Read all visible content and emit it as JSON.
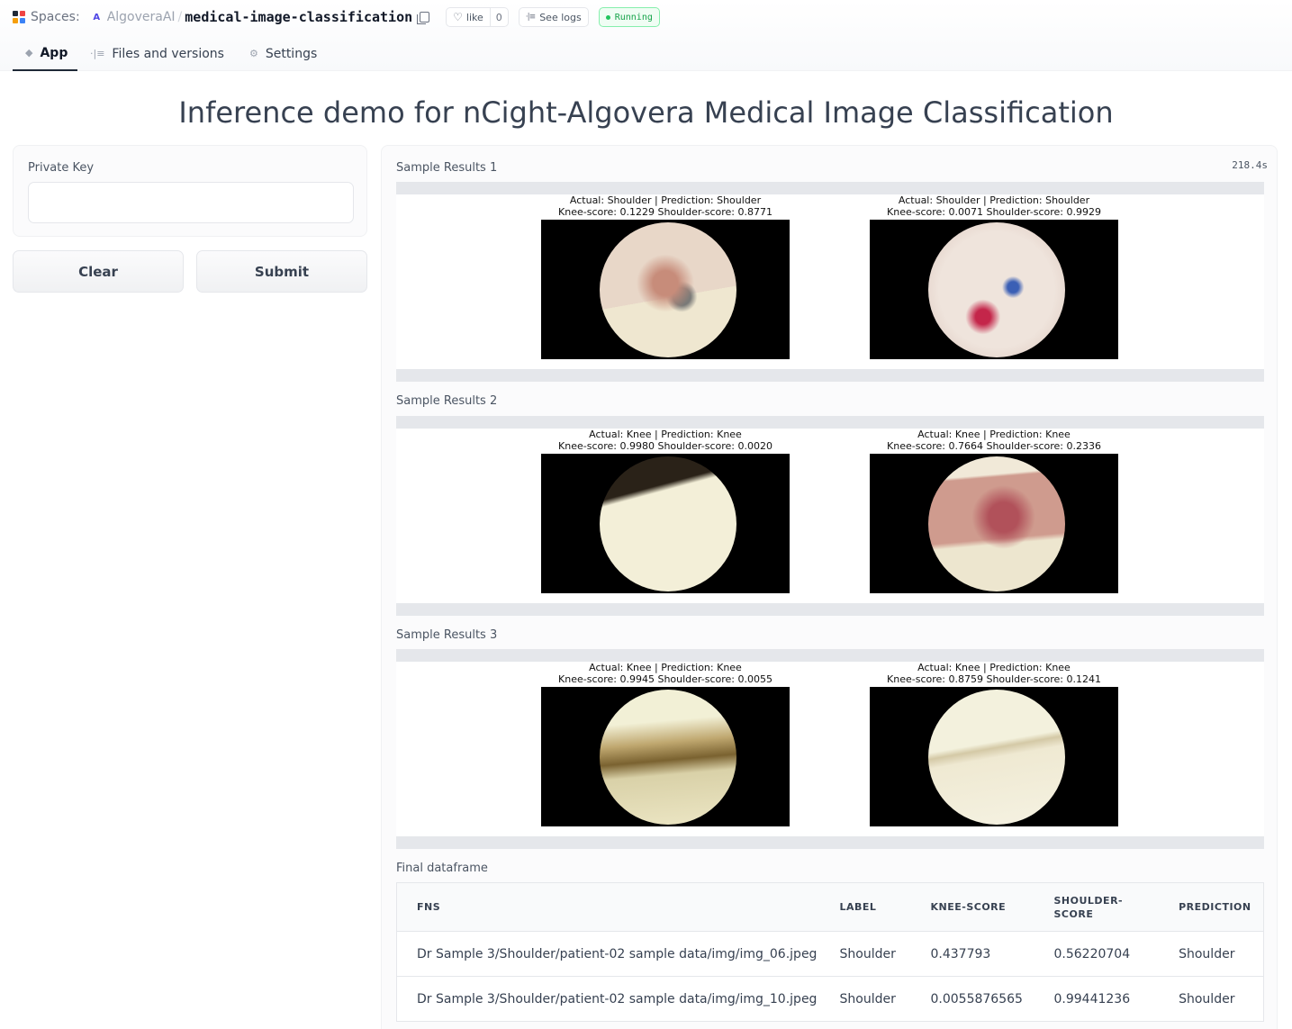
{
  "header": {
    "spaces_label": "Spaces:",
    "org_initial": "A",
    "org": "AlgoveraAI",
    "separator": "/",
    "repo": "medical-image-classification",
    "like_label": "like",
    "like_count": "0",
    "logs_label": "See logs",
    "status": "Running"
  },
  "tabs": [
    {
      "label": "App",
      "icon": "cube-icon"
    },
    {
      "label": "Files and versions",
      "icon": "files-icon"
    },
    {
      "label": "Settings",
      "icon": "gear-icon"
    }
  ],
  "title": "Inference demo for nCight-Algovera Medical Image Classification",
  "input": {
    "label": "Private Key",
    "value": "",
    "placeholder": ""
  },
  "buttons": {
    "clear": "Clear",
    "submit": "Submit"
  },
  "output": {
    "timer": "218.4s",
    "samples": [
      {
        "label": "Sample Results 1",
        "images": [
          {
            "line1": "Actual: Shoulder | Prediction: Shoulder",
            "line2": "Knee-score: 0.1229 Shoulder-score: 0.8771"
          },
          {
            "line1": "Actual: Shoulder | Prediction: Shoulder",
            "line2": "Knee-score: 0.0071 Shoulder-score: 0.9929"
          }
        ]
      },
      {
        "label": "Sample Results 2",
        "images": [
          {
            "line1": "Actual: Knee | Prediction: Knee",
            "line2": "Knee-score: 0.9980 Shoulder-score: 0.0020"
          },
          {
            "line1": "Actual: Knee | Prediction: Knee",
            "line2": "Knee-score: 0.7664 Shoulder-score: 0.2336"
          }
        ]
      },
      {
        "label": "Sample Results 3",
        "images": [
          {
            "line1": "Actual: Knee | Prediction: Knee",
            "line2": "Knee-score: 0.9945 Shoulder-score: 0.0055"
          },
          {
            "line1": "Actual: Knee | Prediction: Knee",
            "line2": "Knee-score: 0.8759 Shoulder-score: 0.1241"
          }
        ]
      }
    ],
    "dataframe": {
      "label": "Final dataframe",
      "columns": [
        "FNS",
        "LABEL",
        "KNEE-SCORE",
        "SHOULDER-SCORE",
        "PREDICTION"
      ],
      "rows": [
        [
          "Dr Sample 3/Shoulder/patient-02 sample data/img/img_06.jpeg",
          "Shoulder",
          "0.437793",
          "0.56220704",
          "Shoulder"
        ],
        [
          "Dr Sample 3/Shoulder/patient-02 sample data/img/img_10.jpeg",
          "Shoulder",
          "0.0055876565",
          "0.99441236",
          "Shoulder"
        ]
      ]
    }
  },
  "colors": {
    "running": "#16a34a",
    "accent": "#1f2937"
  }
}
